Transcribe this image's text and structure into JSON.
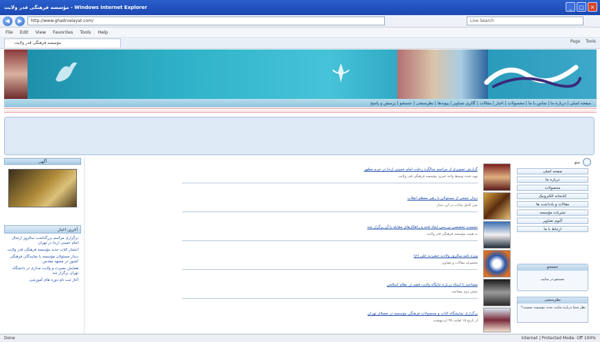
{
  "window": {
    "title": "مؤسسه فرهنگی قدر ولایت - Windows Internet Explorer",
    "url": "http://www.ghadrvelayat.com/",
    "search_placeholder": "Live Search"
  },
  "menu": [
    "File",
    "Edit",
    "View",
    "Favorites",
    "Tools",
    "Help"
  ],
  "tab": {
    "label": "مؤسسه فرهنگی قدر ولایت"
  },
  "toolbar_right": [
    "Page",
    "Tools"
  ],
  "navstrip": {
    "text": "صفحه اصلی | درباره ما | تماس با ما | محصولات | اخبار | مقالات | گالری تصاویر | پیوندها | نظرسنجی | جستجو | پرسش و پاسخ"
  },
  "left": {
    "panel_title": "آگهی",
    "news_title": "آخرین اخبار",
    "news": [
      "برگزاری مراسم بزرگداشت سالروز ارتحال امام خمینی (ره) در تهران",
      "انتشار کتاب جدید مؤسسه فرهنگی قدر ولایت",
      "دیدار مسئولان مؤسسه با نمایندگان فرهنگی کشور در مشهد مقدس",
      "همایش بصیرت و ولایت مداری در دانشگاه تهران برگزار شد",
      "آغاز ثبت نام دوره های آموزشی"
    ]
  },
  "main": {
    "entries": [
      {
        "title": "گزارش تصویری از مراسم سالگرد رحلت امام خمینی (ره) در حرم مطهر",
        "summary": "تهیه شده توسط واحد خبری مؤسسه فرهنگی قدر ولایت"
      },
      {
        "title": "دیدار جمعی از مسئولان با رهبر معظم انقلاب",
        "summary": "متن کامل بیانات در این دیدار"
      },
      {
        "title": "نشست تخصصی بررسی ابعاد فتنه و راهکارهای مقابله با آن برگزار شد",
        "summary": "به همت مؤسسه فرهنگی قدر ولایت"
      },
      {
        "title": "ویژه نامه سالروز ولادت حضرت علی (ع)",
        "summary": "مجموعه مقالات و تصاویر"
      },
      {
        "title": "مصاحبه با استاد درباره جایگاه ولایت فقیه در نظام اسلامی",
        "summary": "بخش دوم مصاحبه"
      },
      {
        "title": "برگزاری نمایشگاه کتاب و محصولات فرهنگی مؤسسه در مصلای تهران",
        "summary": "از تاریخ ۱۵ لغایت ۲۵ اردیبهشت"
      }
    ]
  },
  "right": {
    "header": "منو",
    "buttons": [
      "صفحه اصلی",
      "درباره ما",
      "محصولات",
      "کتابخانه الکترونیک",
      "مقالات و یادداشت ها",
      "نشریات مؤسسه",
      "آلبوم تصاویر",
      "ارتباط با ما"
    ],
    "widget_title": "جستجو",
    "widget_body": "جستجو در سایت",
    "widget2_title": "نظرسنجی",
    "widget2_body": "نظر شما درباره سایت جدید مؤسسه چیست؟"
  },
  "status": {
    "left": "Done",
    "right": "Internet | Protected Mode: Off   100%"
  },
  "colors": {
    "banner": "#2fb2c9",
    "link": "#1a4aa8",
    "titlebar": "#2a5fcc"
  }
}
